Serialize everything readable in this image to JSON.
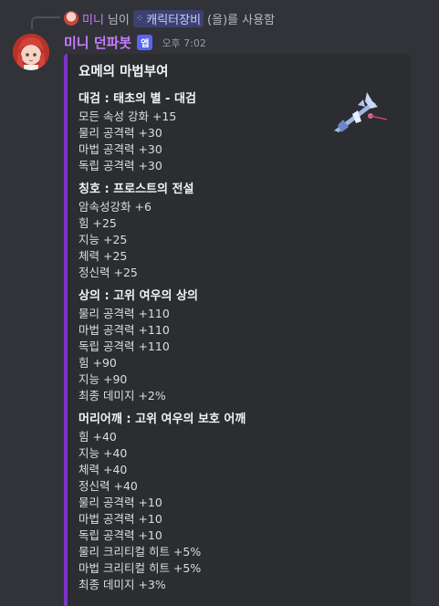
{
  "reply": {
    "user": "미니",
    "suffix": "님이",
    "command": "캐릭터장비",
    "action": "(을)를 사용함"
  },
  "message": {
    "author": "미니 던파봇",
    "bot_tag": "앱",
    "timestamp": "오후 7:02"
  },
  "embed": {
    "accent": "#7b35c9",
    "title": "요메의 마법부여",
    "fields": [
      {
        "name": "대검 : 태초의 별 - 대검",
        "lines": [
          "모든 속성 강화 +15",
          "물리 공격력 +30",
          "마법 공격력 +30",
          "독립 공격력 +30"
        ]
      },
      {
        "name": "칭호 : 프로스트의 전설",
        "lines": [
          "암속성강화 +6",
          "힘 +25",
          "지능 +25",
          "체력 +25",
          "정신력 +25"
        ]
      },
      {
        "name": "상의 : 고위 여우의 상의",
        "lines": [
          "물리 공격력 +110",
          "마법 공격력 +110",
          "독립 공격력 +110",
          "힘 +90",
          "지능 +90",
          "최종 데미지 +2%"
        ]
      },
      {
        "name": "머리어깨 : 고위 여우의 보호 어깨",
        "lines": [
          "힘 +40",
          "지능 +40",
          "체력 +40",
          "정신력 +40",
          "물리 공격력 +10",
          "마법 공격력 +10",
          "독립 공격력 +10",
          "물리 크리티컬 히트 +5%",
          "마법 크리티컬 히트 +5%",
          "최종 데미지 +3%"
        ]
      }
    ]
  }
}
